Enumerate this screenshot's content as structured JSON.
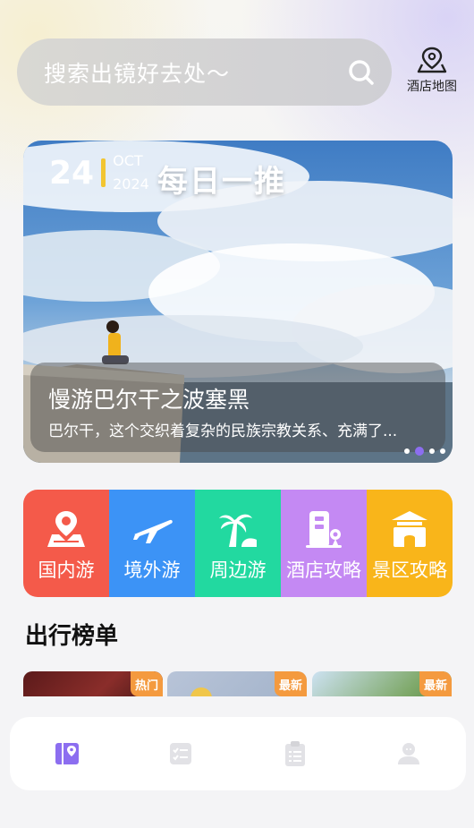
{
  "search": {
    "placeholder": "搜索出镜好去处～"
  },
  "hotel_map": {
    "label": "酒店地图",
    "icon": "map-pin-icon"
  },
  "banner": {
    "day": "24",
    "month": "OCT",
    "year": "2024",
    "daily_label": "每日一推",
    "title": "慢游巴尔干之波塞黑",
    "description": "巴尔干，这个交织着复杂的民族宗教关系、充满了...",
    "active_dot": 1,
    "dot_count": 4
  },
  "categories": [
    {
      "label": "国内游",
      "icon": "map-icon",
      "color": "#f45a4a"
    },
    {
      "label": "境外游",
      "icon": "airplane-icon",
      "color": "#3c93f6"
    },
    {
      "label": "周边游",
      "icon": "palm-tree-icon",
      "color": "#22d9a0"
    },
    {
      "label": "酒店攻略",
      "icon": "hotel-icon",
      "color": "#c489f3"
    },
    {
      "label": "景区攻略",
      "icon": "gate-icon",
      "color": "#f9b51a"
    }
  ],
  "section": {
    "title": "出行榜单"
  },
  "rank_cards": [
    {
      "tag": "热门"
    },
    {
      "tag": "最新"
    },
    {
      "tag": "最新"
    }
  ],
  "tabbar": [
    {
      "name": "tab-discover",
      "icon": "bookmark-map-icon",
      "active": true
    },
    {
      "name": "tab-checklist",
      "icon": "checklist-icon",
      "active": false
    },
    {
      "name": "tab-notes",
      "icon": "clipboard-icon",
      "active": false
    },
    {
      "name": "tab-profile",
      "icon": "user-icon",
      "active": false
    }
  ],
  "colors": {
    "accent": "#8c6ef0",
    "tab_inactive": "#d4d4d8",
    "tag": "#f49a3f"
  }
}
